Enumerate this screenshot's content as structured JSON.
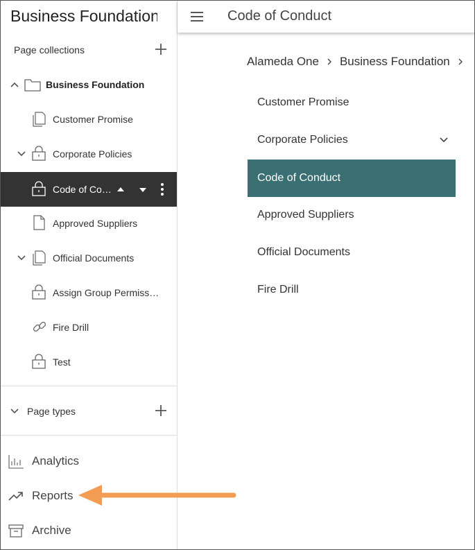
{
  "app": {
    "title": "Business Foundation"
  },
  "sidebar": {
    "page_collections_label": "Page collections",
    "tree": [
      {
        "label": "Business Foundation",
        "icon": "folder-icon"
      },
      {
        "label": "Customer Promise",
        "icon": "pages-icon"
      },
      {
        "label": "Corporate Policies",
        "icon": "lock-icon"
      },
      {
        "label": "Code of Conduct",
        "icon": "lock-icon"
      },
      {
        "label": "Approved Suppliers",
        "icon": "page-icon"
      },
      {
        "label": "Official Documents",
        "icon": "pages-icon"
      },
      {
        "label": "Assign Group Permissions",
        "icon": "lock-icon"
      },
      {
        "label": "Fire Drill",
        "icon": "link-icon"
      },
      {
        "label": "Test",
        "icon": "lock-icon"
      }
    ],
    "page_types_label": "Page types",
    "nav": [
      {
        "label": "Analytics",
        "icon": "bar-chart-icon"
      },
      {
        "label": "Reports",
        "icon": "trending-up-icon"
      },
      {
        "label": "Archive",
        "icon": "archive-icon"
      }
    ]
  },
  "topbar": {
    "title": "Code of Conduct"
  },
  "breadcrumb": {
    "items": [
      "Alameda One",
      "Business Foundation"
    ]
  },
  "menu": {
    "items": [
      "Customer Promise",
      "Corporate Policies",
      "Code of Conduct",
      "Approved Suppliers",
      "Official Documents",
      "Fire Drill"
    ]
  },
  "colors": {
    "selected_row": "#333333",
    "active_menu": "#3a7073",
    "annotation_arrow": "#f39c53"
  }
}
